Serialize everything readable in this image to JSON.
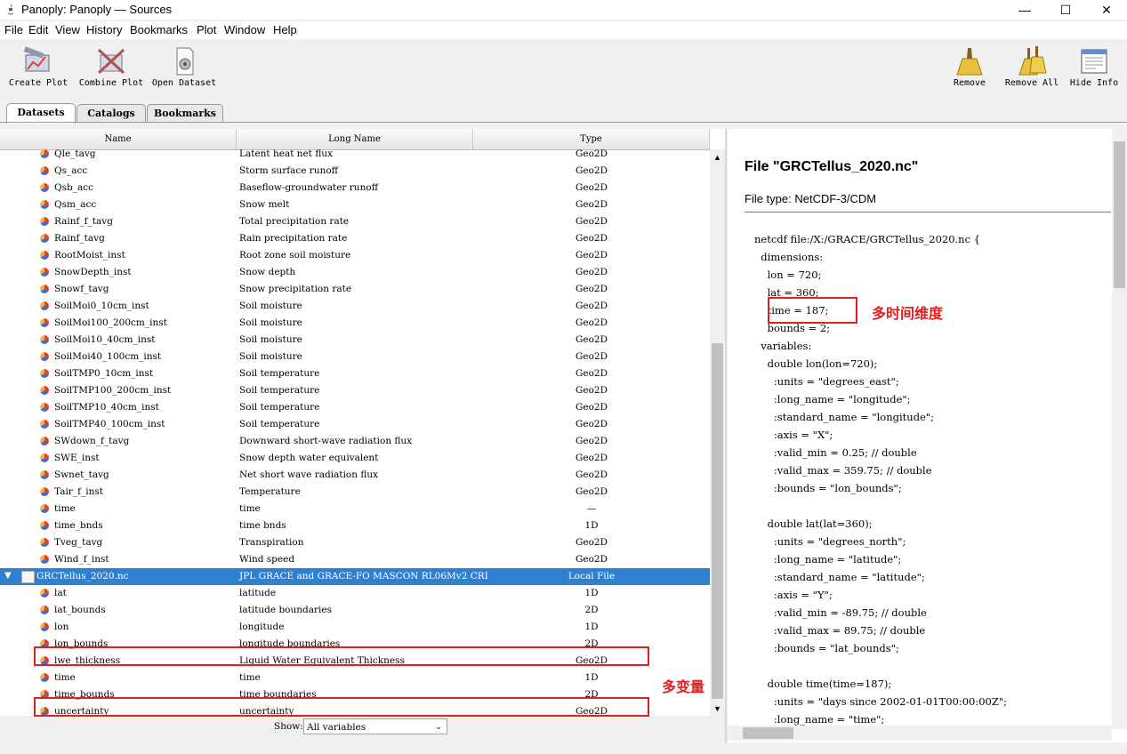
{
  "window": {
    "title": "Panoply: Panoply — Sources",
    "minimize": "—",
    "maximize": "☐",
    "close": "✕"
  },
  "menu": [
    "File",
    "Edit",
    "View",
    "History",
    "Bookmarks",
    "Plot",
    "Window",
    "Help"
  ],
  "toolbar": {
    "create_plot": "Create Plot",
    "combine_plot": "Combine Plot",
    "open_dataset": "Open Dataset",
    "remove": "Remove",
    "remove_all": "Remove All",
    "hide_info": "Hide Info"
  },
  "tabs": [
    "Datasets",
    "Catalogs",
    "Bookmarks"
  ],
  "table": {
    "columns": [
      "Name",
      "Long Name",
      "Type"
    ],
    "rows": [
      {
        "name": "Qle_tavg",
        "long_name": "Latent heat net flux",
        "type": "Geo2D"
      },
      {
        "name": "Qs_acc",
        "long_name": "Storm surface runoff",
        "type": "Geo2D"
      },
      {
        "name": "Qsb_acc",
        "long_name": "Baseflow-groundwater runoff",
        "type": "Geo2D"
      },
      {
        "name": "Qsm_acc",
        "long_name": "Snow melt",
        "type": "Geo2D"
      },
      {
        "name": "Rainf_f_tavg",
        "long_name": "Total precipitation rate",
        "type": "Geo2D"
      },
      {
        "name": "Rainf_tavg",
        "long_name": "Rain precipitation rate",
        "type": "Geo2D"
      },
      {
        "name": "RootMoist_inst",
        "long_name": "Root zone soil moisture",
        "type": "Geo2D"
      },
      {
        "name": "SnowDepth_inst",
        "long_name": "Snow depth",
        "type": "Geo2D"
      },
      {
        "name": "Snowf_tavg",
        "long_name": "Snow precipitation rate",
        "type": "Geo2D"
      },
      {
        "name": "SoilMoi0_10cm_inst",
        "long_name": "Soil moisture",
        "type": "Geo2D"
      },
      {
        "name": "SoilMoi100_200cm_inst",
        "long_name": "Soil moisture",
        "type": "Geo2D"
      },
      {
        "name": "SoilMoi10_40cm_inst",
        "long_name": "Soil moisture",
        "type": "Geo2D"
      },
      {
        "name": "SoilMoi40_100cm_inst",
        "long_name": "Soil moisture",
        "type": "Geo2D"
      },
      {
        "name": "SoilTMP0_10cm_inst",
        "long_name": "Soil temperature",
        "type": "Geo2D"
      },
      {
        "name": "SoilTMP100_200cm_inst",
        "long_name": "Soil temperature",
        "type": "Geo2D"
      },
      {
        "name": "SoilTMP10_40cm_inst",
        "long_name": "Soil temperature",
        "type": "Geo2D"
      },
      {
        "name": "SoilTMP40_100cm_inst",
        "long_name": "Soil temperature",
        "type": "Geo2D"
      },
      {
        "name": "SWdown_f_tavg",
        "long_name": "Downward short-wave radiation flux",
        "type": "Geo2D"
      },
      {
        "name": "SWE_inst",
        "long_name": "Snow depth water equivalent",
        "type": "Geo2D"
      },
      {
        "name": "Swnet_tavg",
        "long_name": "Net short wave radiation flux",
        "type": "Geo2D"
      },
      {
        "name": "Tair_f_inst",
        "long_name": "Temperature",
        "type": "Geo2D"
      },
      {
        "name": "time",
        "long_name": "time",
        "type": "—"
      },
      {
        "name": "time_bnds",
        "long_name": "time bnds",
        "type": "1D"
      },
      {
        "name": "Tveg_tavg",
        "long_name": "Transpiration",
        "type": "Geo2D"
      },
      {
        "name": "Wind_f_inst",
        "long_name": "Wind speed",
        "type": "Geo2D"
      },
      {
        "name": "GRCTellus_2020.nc",
        "long_name": "JPL GRACE and GRACE-FO MASCON RL06Mv2 CRI",
        "type": "Local File",
        "dataset": true
      },
      {
        "name": "lat",
        "long_name": "latitude",
        "type": "1D"
      },
      {
        "name": "lat_bounds",
        "long_name": "latitude boundaries",
        "type": "2D"
      },
      {
        "name": "lon",
        "long_name": "longitude",
        "type": "1D"
      },
      {
        "name": "lon_bounds",
        "long_name": "longitude boundaries",
        "type": "2D"
      },
      {
        "name": "lwe_thickness",
        "long_name": "Liquid Water Equivalent Thickness",
        "type": "Geo2D"
      },
      {
        "name": "time",
        "long_name": "time",
        "type": "1D"
      },
      {
        "name": "time_bounds",
        "long_name": "time boundaries",
        "type": "2D"
      },
      {
        "name": "uncertainty",
        "long_name": "uncertainty",
        "type": "Geo2D"
      }
    ]
  },
  "show": {
    "label": "Show:",
    "value": "All variables"
  },
  "info": {
    "heading": "File \"GRCTellus_2020.nc\"",
    "file_type": "File type: NetCDF-3/CDM",
    "cdl": "netcdf file:/X:/GRACE/GRCTellus_2020.nc {\n  dimensions:\n    lon = 720;\n    lat = 360;\n    time = 187;\n    bounds = 2;\n  variables:\n    double lon(lon=720);\n      :units = \"degrees_east\";\n      :long_name = \"longitude\";\n      :standard_name = \"longitude\";\n      :axis = \"X\";\n      :valid_min = 0.25; // double\n      :valid_max = 359.75; // double\n      :bounds = \"lon_bounds\";\n\n    double lat(lat=360);\n      :units = \"degrees_north\";\n      :long_name = \"latitude\";\n      :standard_name = \"latitude\";\n      :axis = \"Y\";\n      :valid_min = -89.75; // double\n      :valid_max = 89.75; // double\n      :bounds = \"lat_bounds\";\n\n    double time(time=187);\n      :units = \"days since 2002-01-01T00:00:00Z\";\n      :long_name = \"time\";"
  },
  "annotations": {
    "time_dim": "多时间维度",
    "multi_var": "多变量"
  },
  "colors": {
    "selection": "#2e80d2",
    "annotation": "#e02020"
  }
}
